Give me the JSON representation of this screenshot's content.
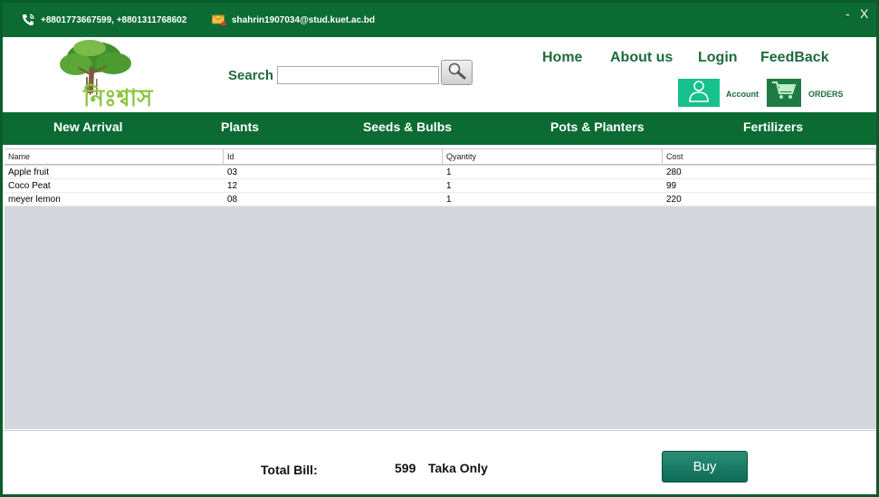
{
  "topbar": {
    "phone": "+8801773667599, +8801311768602",
    "email": "shahrin1907034@stud.kuet.ac.bd",
    "minimize_label": "-",
    "close_label": "X"
  },
  "header": {
    "logo_text": "নিঃশ্বাস",
    "search_label": "Search",
    "search_value": "",
    "nav": [
      "Home",
      "About us",
      "Login",
      "FeedBack"
    ],
    "account_label": "Account",
    "orders_label": "ORDERS"
  },
  "categories": [
    "New Arrival",
    "Plants",
    "Seeds & Bulbs",
    "Pots & Planters",
    "Fertilizers"
  ],
  "table": {
    "columns": [
      "Name",
      "Id",
      "Qyantity",
      "Cost"
    ],
    "rows": [
      [
        "Apple fruit",
        "03",
        "1",
        "280"
      ],
      [
        "Coco Peat",
        "12",
        "1",
        "99"
      ],
      [
        "meyer lemon",
        "08",
        "1",
        "220"
      ]
    ]
  },
  "footer": {
    "total_label": "Total Bill:",
    "total_value": "599",
    "total_suffix": "Taka Only",
    "buy_label": "Buy"
  },
  "colors": {
    "brand_green": "#0b6b33",
    "accent_teal": "#16c18d",
    "buy_button": "#0c6b55"
  },
  "icons": {
    "phone": "phone-icon",
    "email": "mail-icon",
    "search": "magnifier-icon",
    "account": "user-icon",
    "orders": "cart-icon"
  }
}
